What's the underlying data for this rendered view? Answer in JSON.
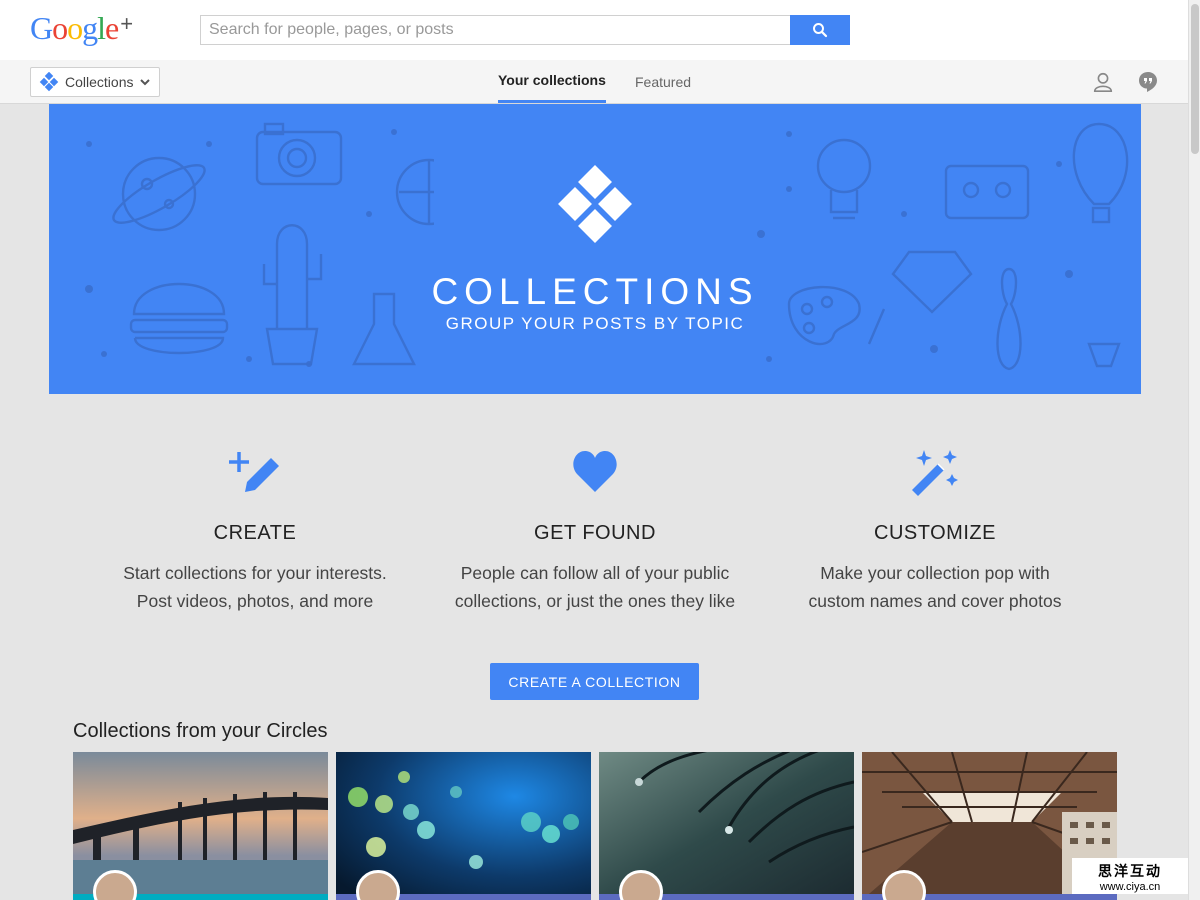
{
  "brand": {
    "logo_letters": [
      "G",
      "o",
      "o",
      "g",
      "l",
      "e"
    ],
    "logo_colors": [
      "#4285f4",
      "#ea4335",
      "#fbbc05",
      "#4285f4",
      "#34a853",
      "#ea4335"
    ],
    "logo_plus": "+"
  },
  "search": {
    "placeholder": "Search for people, pages, or posts",
    "value": "",
    "button_icon": "search-icon"
  },
  "subnav": {
    "dropdown_label": "Collections",
    "tabs": [
      {
        "label": "Your collections",
        "active": true
      },
      {
        "label": "Featured",
        "active": false
      }
    ],
    "right_icons": [
      "notifications-person-icon",
      "hangouts-icon"
    ]
  },
  "hero": {
    "title": "COLLECTIONS",
    "subtitle": "GROUP YOUR POSTS BY TOPIC",
    "background": "#4285f4"
  },
  "features": [
    {
      "icon": "add-edit-icon",
      "title": "CREATE",
      "line1": "Start collections for your interests.",
      "line2": "Post videos, photos, and more"
    },
    {
      "icon": "heart-icon",
      "title": "GET FOUND",
      "line1": "People can follow all of your public",
      "line2": "collections, or just the ones they like"
    },
    {
      "icon": "magic-wand-icon",
      "title": "CUSTOMIZE",
      "line1": "Make your collection pop with",
      "line2": "custom names and cover photos"
    }
  ],
  "cta_label": "CREATE A COLLECTION",
  "section_title": "Collections from your Circles",
  "cards": [
    {
      "image": "bridge-sunset-photo",
      "strip_color": "#00acc1"
    },
    {
      "image": "bokeh-lights-photo",
      "strip_color": "#5c6bc0"
    },
    {
      "image": "water-droplet-photo",
      "strip_color": "#5c6bc0"
    },
    {
      "image": "building-lookup-photo",
      "strip_color": "#5c6bc0"
    }
  ],
  "watermark": {
    "line1": "思洋互动",
    "line2": "www.ciya.cn"
  },
  "colors": {
    "accent": "#4285f4",
    "background": "#e5e5e5"
  }
}
